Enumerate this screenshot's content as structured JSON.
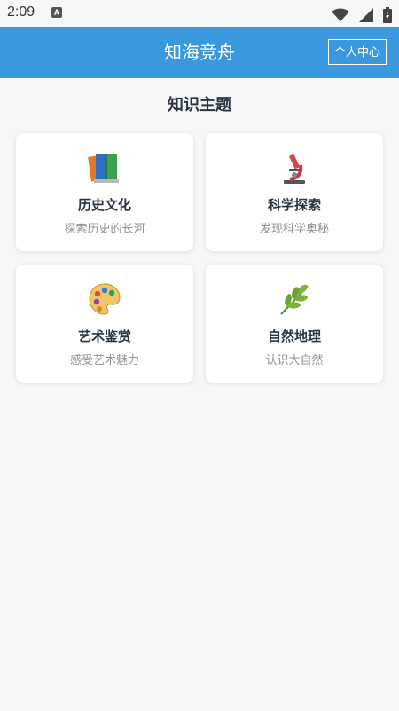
{
  "status_bar": {
    "time": "2:09",
    "app_badge": "A",
    "icons": [
      "wifi-icon",
      "signal-icon",
      "battery-icon"
    ]
  },
  "app_bar": {
    "title": "知海竞舟",
    "profile_button": "个人中心",
    "color": "#3a98de"
  },
  "main": {
    "section_title": "知识主题",
    "topics": [
      {
        "title": "历史文化",
        "subtitle": "探索历史的长河",
        "icon": "books-icon"
      },
      {
        "title": "科学探索",
        "subtitle": "发现科学奥秘",
        "icon": "microscope-icon"
      },
      {
        "title": "艺术鉴赏",
        "subtitle": "感受艺术魅力",
        "icon": "palette-icon"
      },
      {
        "title": "自然地理",
        "subtitle": "认识大自然",
        "icon": "herb-icon"
      }
    ]
  }
}
